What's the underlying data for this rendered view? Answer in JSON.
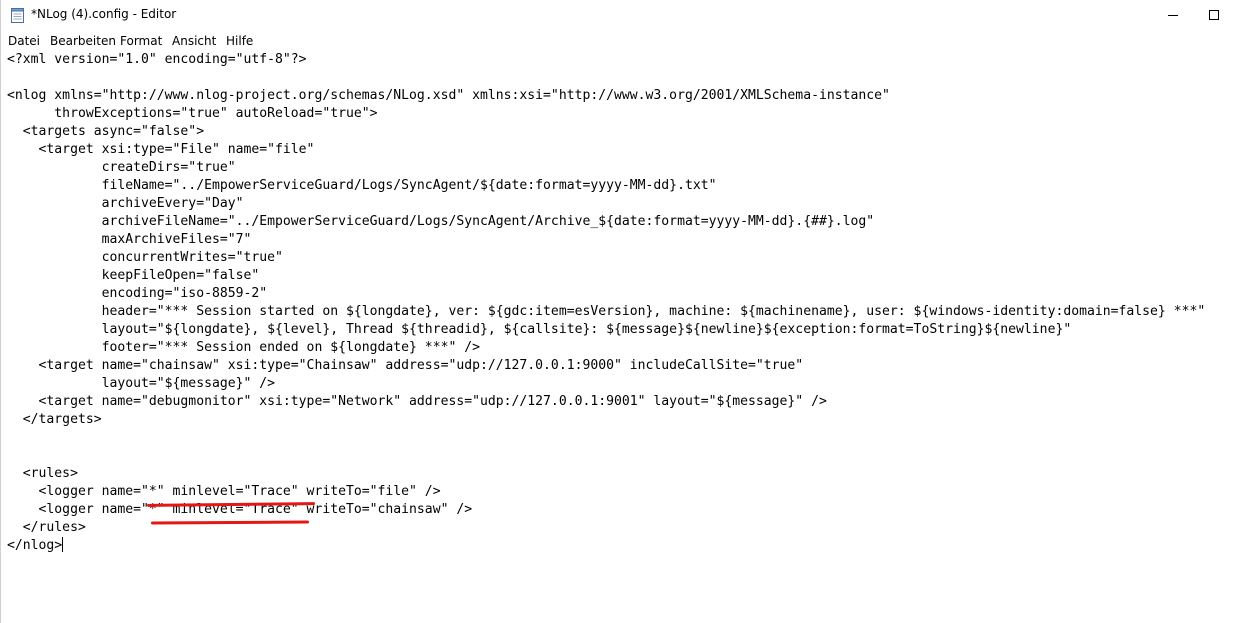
{
  "window": {
    "title": "*NLog (4).config - Editor",
    "icon": "notepad-icon",
    "controls": [
      "minimize-icon",
      "maximize-icon"
    ]
  },
  "menu": {
    "items": [
      "Datei",
      "Bearbeiten",
      "Format",
      "Ansicht",
      "Hilfe"
    ]
  },
  "editor": {
    "lines": [
      "<?xml version=\"1.0\" encoding=\"utf-8\"?>",
      "",
      "<nlog xmlns=\"http://www.nlog-project.org/schemas/NLog.xsd\" xmlns:xsi=\"http://www.w3.org/2001/XMLSchema-instance\"",
      "      throwExceptions=\"true\" autoReload=\"true\">",
      "  <targets async=\"false\">",
      "    <target xsi:type=\"File\" name=\"file\"",
      "            createDirs=\"true\"",
      "            fileName=\"../EmpowerServiceGuard/Logs/SyncAgent/${date:format=yyyy-MM-dd}.txt\"",
      "            archiveEvery=\"Day\"",
      "            archiveFileName=\"../EmpowerServiceGuard/Logs/SyncAgent/Archive_${date:format=yyyy-MM-dd}.{##}.log\"",
      "            maxArchiveFiles=\"7\"",
      "            concurrentWrites=\"true\"",
      "            keepFileOpen=\"false\"",
      "            encoding=\"iso-8859-2\"",
      "            header=\"*** Session started on ${longdate}, ver: ${gdc:item=esVersion}, machine: ${machinename}, user: ${windows-identity:domain=false} ***\"",
      "            layout=\"${longdate}, ${level}, Thread ${threadid}, ${callsite}: ${message}${newline}${exception:format=ToString}${newline}\"",
      "            footer=\"*** Session ended on ${longdate} ***\" />",
      "    <target name=\"chainsaw\" xsi:type=\"Chainsaw\" address=\"udp://127.0.0.1:9000\" includeCallSite=\"true\"",
      "            layout=\"${message}\" />",
      "    <target name=\"debugmonitor\" xsi:type=\"Network\" address=\"udp://127.0.0.1:9001\" layout=\"${message}\" />",
      "  </targets>",
      "",
      "",
      "  <rules>",
      "    <logger name=\"*\" minlevel=\"Trace\" writeTo=\"file\" />",
      "    <logger name=\"*\" minlevel=\"Trace\" writeTo=\"chainsaw\" />",
      "  </rules>",
      "</nlog>"
    ],
    "annotation_color": "#e41616"
  }
}
